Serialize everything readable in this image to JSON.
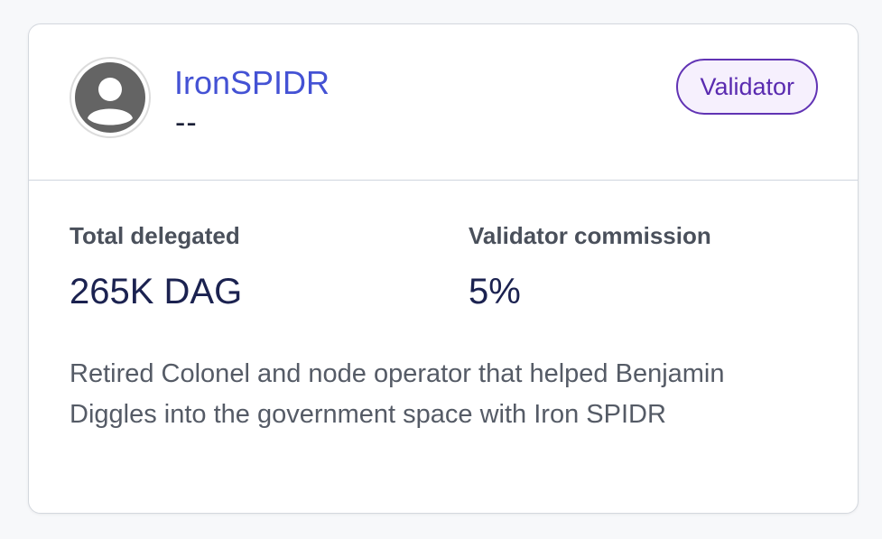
{
  "validator": {
    "name": "IronSPIDR",
    "subtitle": "--",
    "badge": "Validator",
    "stats": {
      "total_delegated_label": "Total delegated",
      "total_delegated_value": "265K DAG",
      "commission_label": "Validator commission",
      "commission_value": "5%"
    },
    "description": "Retired Colonel and node operator that helped Benjamin Diggles into the government space with Iron SPIDR"
  },
  "icons": {
    "avatar": "user-avatar-icon"
  },
  "colors": {
    "name_link": "#4452d4",
    "badge_border": "#6133b4",
    "badge_bg": "#f6f0fd",
    "value_text": "#1b2250"
  }
}
